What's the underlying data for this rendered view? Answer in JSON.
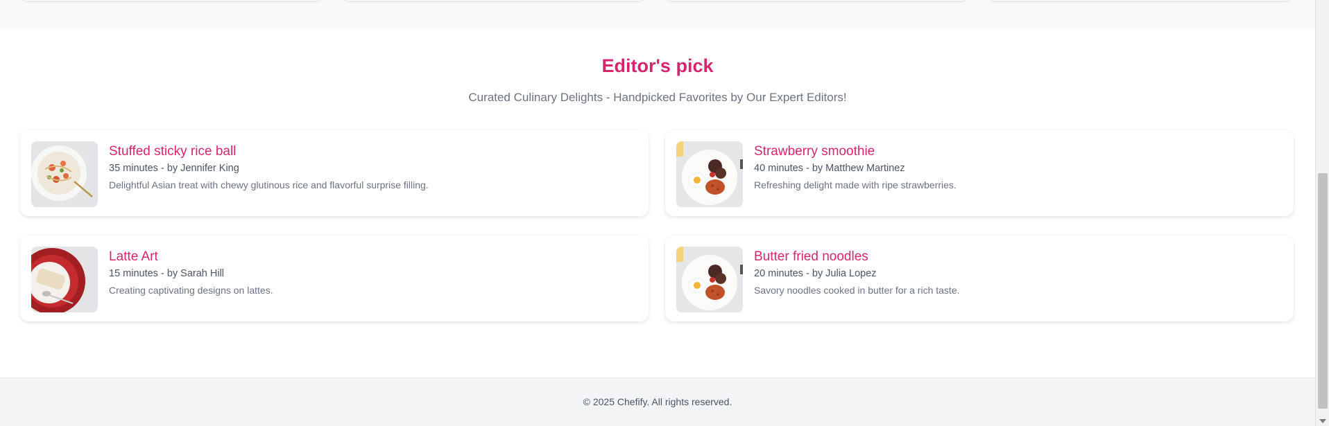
{
  "section": {
    "title": "Editor's pick",
    "subtitle": "Curated Culinary Delights - Handpicked Favorites by Our Expert Editors!"
  },
  "recipes": [
    {
      "title": "Stuffed sticky rice ball",
      "meta": "35 minutes - by Jennifer King",
      "description": "Delightful Asian treat with chewy glutinous rice and flavorful surprise filling.",
      "image": "pasta-plate-image"
    },
    {
      "title": "Strawberry smoothie",
      "meta": "40 minutes - by Matthew Martinez",
      "description": "Refreshing delight made with ripe strawberries.",
      "image": "breakfast-plate-image"
    },
    {
      "title": "Latte Art",
      "meta": "15 minutes - by Sarah Hill",
      "description": "Creating captivating designs on lattes.",
      "image": "red-plate-wrap-image"
    },
    {
      "title": "Butter fried noodles",
      "meta": "20 minutes - by Julia Lopez",
      "description": "Savory noodles cooked in butter for a rich taste.",
      "image": "breakfast-plate-image"
    }
  ],
  "footer": {
    "copyright": "© 2025 Chefify. All rights reserved."
  },
  "colors": {
    "accent": "#d6246e",
    "muted_text": "#6b7280",
    "footer_bg": "#f3f4f6"
  }
}
